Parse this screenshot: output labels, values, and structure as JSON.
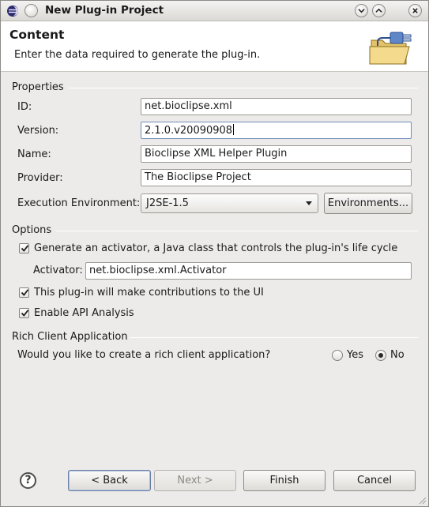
{
  "window": {
    "title": "New Plug-in Project"
  },
  "header": {
    "title": "Content",
    "message": "Enter the data required to generate the plug-in."
  },
  "properties": {
    "group_label": "Properties",
    "id_label": "ID:",
    "id_value": "net.bioclipse.xml",
    "version_label": "Version:",
    "version_value": "2.1.0.v20090908",
    "name_label": "Name:",
    "name_value": "Bioclipse XML Helper Plugin",
    "provider_label": "Provider:",
    "provider_value": "The Bioclipse Project",
    "exec_env_label": "Execution Environment:",
    "exec_env_value": "J2SE-1.5",
    "environments_button": "Environments..."
  },
  "options": {
    "group_label": "Options",
    "generate_activator_label": "Generate an activator, a Java class that controls the plug-in's life cycle",
    "generate_activator_checked": true,
    "activator_label": "Activator:",
    "activator_value": "net.bioclipse.xml.Activator",
    "ui_contrib_label": "This plug-in will make contributions to the UI",
    "ui_contrib_checked": true,
    "api_analysis_label": "Enable API Analysis",
    "api_analysis_checked": true
  },
  "rcp": {
    "group_label": "Rich Client Application",
    "question": "Would you like to create a rich client application?",
    "yes_label": "Yes",
    "no_label": "No",
    "selected": "No"
  },
  "footer": {
    "help_glyph": "?",
    "back_button": "< Back",
    "next_button": "Next >",
    "finish_button": "Finish",
    "cancel_button": "Cancel"
  },
  "icons": {
    "app": "eclipse-icon",
    "wizard_banner": "plugin-folder-icon"
  }
}
